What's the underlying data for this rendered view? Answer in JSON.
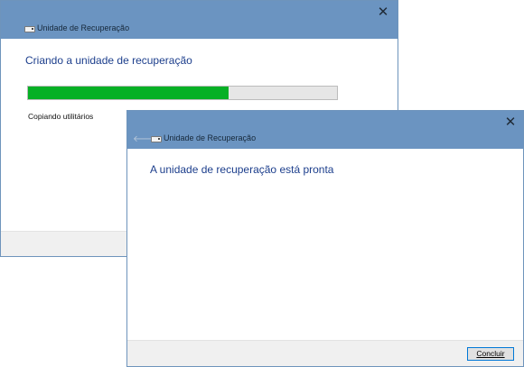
{
  "colors": {
    "titlebar": "#6b94c1",
    "heading_text": "#1c3e8c",
    "progress_fill": "#06b025",
    "footer": "#f0f0f0",
    "button_border": "#0078d7"
  },
  "back_window": {
    "title": "Unidade de Recuperação",
    "close_icon": "close-icon",
    "heading": "Criando a unidade de recuperação",
    "progress_fraction": 0.65,
    "status": "Copiando utilitários"
  },
  "front_window": {
    "title": "Unidade de Recuperação",
    "close_icon": "close-icon",
    "back_icon": "back-arrow-icon",
    "heading": "A unidade de recuperação está pronta",
    "finish_button": "Concluir"
  }
}
